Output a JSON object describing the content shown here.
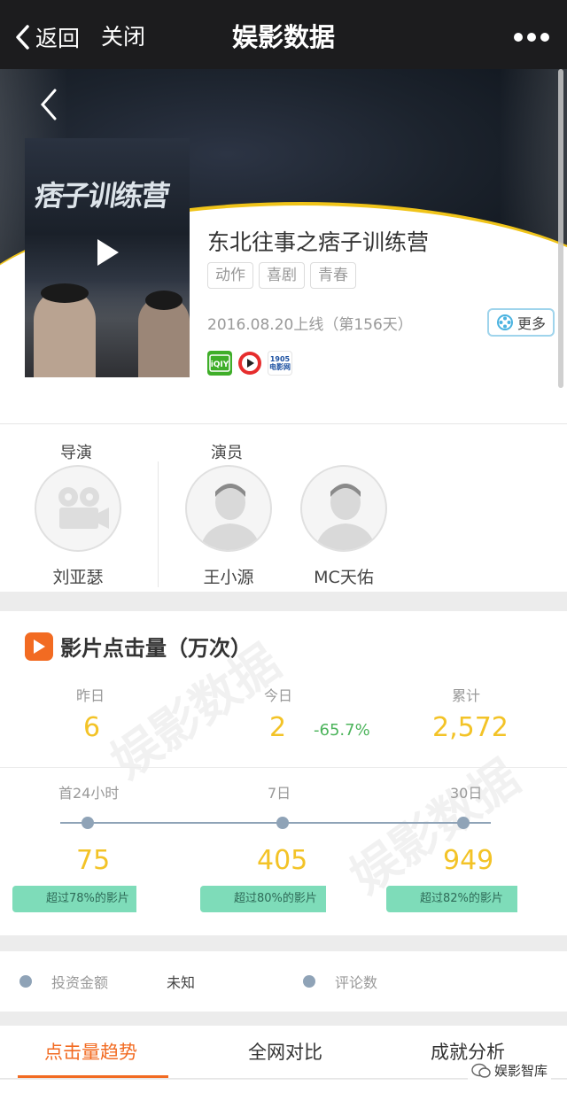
{
  "nav": {
    "back_label": "返回",
    "close_label": "关闭",
    "title": "娱影数据"
  },
  "movie": {
    "title": "东北往事之痞子训练营",
    "poster_text": "痞子训练营",
    "tags": [
      "动作",
      "喜剧",
      "青春"
    ],
    "release": "2016.08.20上线（第156天）",
    "more_label": "更多",
    "platforms": [
      "iqiyi-icon",
      "youku-icon",
      "1905-icon"
    ],
    "platform_1905_top": "1905",
    "platform_1905_bottom": "电影网"
  },
  "crew": {
    "director_label": "导演",
    "actor_label": "演员",
    "director": {
      "name": "刘亚瑟"
    },
    "actors": [
      {
        "name": "王小源"
      },
      {
        "name": "MC天佑"
      }
    ]
  },
  "clicks": {
    "title": "影片点击量（万次）",
    "yesterday_label": "昨日",
    "yesterday_value": "6",
    "today_label": "今日",
    "today_value": "2",
    "today_change": "-65.7%",
    "total_label": "累计",
    "total_value": "2,572",
    "periods": [
      {
        "label": "首24小时",
        "value": "75",
        "badge": "超过78%的影片"
      },
      {
        "label": "7日",
        "value": "405",
        "badge": "超过80%的影片"
      },
      {
        "label": "30日",
        "value": "949",
        "badge": "超过82%的影片"
      }
    ],
    "watermark": "娱影数据"
  },
  "info": {
    "investment_label": "投资金额",
    "investment_value": "未知",
    "comments_label": "评论数"
  },
  "tabs": [
    "点击量趋势",
    "全网对比",
    "成就分析"
  ],
  "wechat_account": "娱影智库",
  "colors": {
    "accent": "#f26b22",
    "value_yellow": "#f3c327",
    "badge_green": "#7edcb9",
    "change_green": "#4cb45b"
  }
}
